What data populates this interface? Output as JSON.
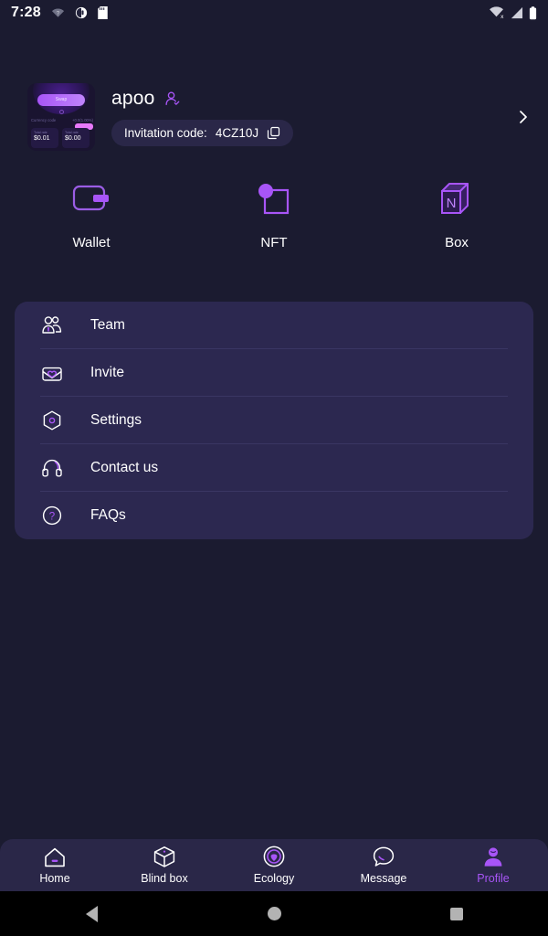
{
  "statusbar": {
    "time": "7:28",
    "left_icons": [
      "wifi-off-icon",
      "vpn-key-icon",
      "sd-card-icon"
    ],
    "right_icons": [
      "wifi-slash-icon",
      "cellular-signal-icon",
      "battery-icon"
    ]
  },
  "profile": {
    "avatar_name": "avatar-thumbnail",
    "avatar_preview": {
      "swap_label": "Swap",
      "row_left": "Currency code",
      "row_right": "+0.0(1.00%)",
      "card_left_label": "Total rate",
      "card_left_value": "$0.01",
      "card_right_label": "Total rate",
      "card_right_value": "$0.00"
    },
    "username": "apoo",
    "verified_icon": "verified-user-icon",
    "invitation_label": "Invitation code:",
    "invitation_code": "4CZ10J",
    "copy_icon": "copy-icon",
    "chevron_icon": "chevron-right-icon"
  },
  "quick_actions": [
    {
      "label": "Wallet",
      "icon": "wallet-icon"
    },
    {
      "label": "NFT",
      "icon": "nft-icon"
    },
    {
      "label": "Box",
      "icon": "box-n-icon"
    }
  ],
  "menu": [
    {
      "label": "Team",
      "icon": "team-icon"
    },
    {
      "label": "Invite",
      "icon": "invite-envelope-icon"
    },
    {
      "label": "Settings",
      "icon": "settings-hexagon-icon"
    },
    {
      "label": "Contact us",
      "icon": "headset-icon"
    },
    {
      "label": "FAQs",
      "icon": "question-circle-icon"
    }
  ],
  "bottom_nav": {
    "active": "Profile",
    "items": [
      {
        "label": "Home",
        "icon": "home-icon"
      },
      {
        "label": "Blind box",
        "icon": "blind-box-icon"
      },
      {
        "label": "Ecology",
        "icon": "ecology-icon"
      },
      {
        "label": "Message",
        "icon": "message-bubble-icon"
      },
      {
        "label": "Profile",
        "icon": "profile-person-icon"
      }
    ]
  },
  "android_nav": {
    "back": "back-button",
    "home": "home-button",
    "recents": "recents-button"
  },
  "colors": {
    "background": "#1b1b30",
    "card": "#2c2850",
    "nav_bar": "#2a2748",
    "accent": "#a855f7",
    "text": "#ffffff",
    "divider": "#3a3663"
  }
}
